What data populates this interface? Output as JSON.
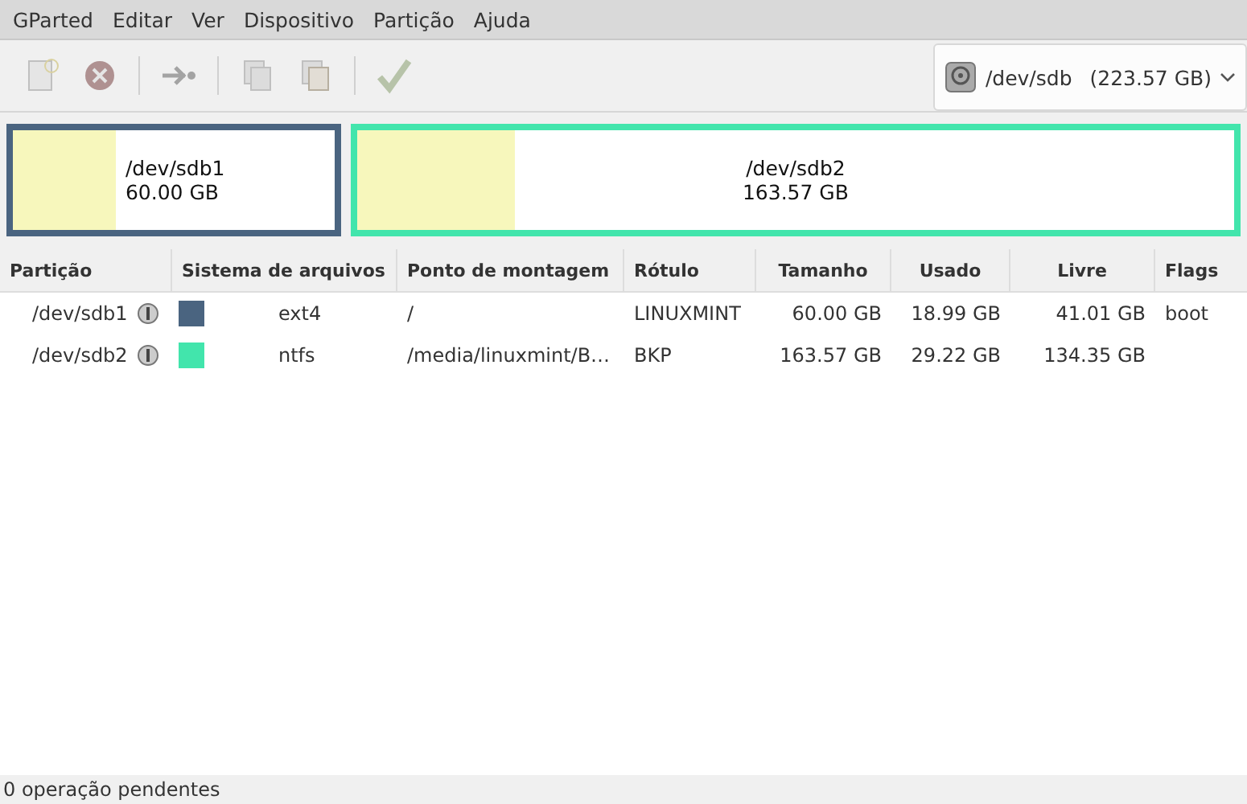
{
  "menu": [
    "GParted",
    "Editar",
    "Ver",
    "Dispositivo",
    "Partição",
    "Ajuda"
  ],
  "toolbar": [
    {
      "kind": "new",
      "disabled": true
    },
    {
      "kind": "delete",
      "disabled": true
    },
    {
      "kind": "sep"
    },
    {
      "kind": "resize",
      "disabled": true
    },
    {
      "kind": "sep"
    },
    {
      "kind": "copy",
      "disabled": true
    },
    {
      "kind": "paste",
      "disabled": true
    },
    {
      "kind": "sep"
    },
    {
      "kind": "apply",
      "disabled": true
    }
  ],
  "device": {
    "name": "/dev/sdb",
    "size": "(223.57 GB)"
  },
  "map": [
    {
      "name": "/dev/sdb1",
      "size": "60.00 GB",
      "color": "#4a6480",
      "level": 0.32
    },
    {
      "name": "/dev/sdb2",
      "size": "163.57 GB",
      "color": "#42e5ac",
      "level": 0.18
    }
  ],
  "table": {
    "columns": [
      "Partição",
      "Sistema de arquivos",
      "Ponto de montagem",
      "Rótulo",
      "Tamanho",
      "Usado",
      "Livre",
      "Flags"
    ],
    "rows": [
      {
        "partition": "/dev/sdb1",
        "color": "#4a6480",
        "filesystem": "ext4",
        "mount": "/",
        "label": "LINUXMINT",
        "size": "60.00 GB",
        "used": "18.99 GB",
        "free": "41.01 GB",
        "flags": "boot"
      },
      {
        "partition": "/dev/sdb2",
        "color": "#42e5ac",
        "filesystem": "ntfs",
        "mount": "/media/linuxmint/B…",
        "label": "BKP",
        "size": "163.57 GB",
        "used": "29.22 GB",
        "free": "134.35 GB",
        "flags": ""
      }
    ]
  },
  "status_bar": "0 operação pendentes"
}
